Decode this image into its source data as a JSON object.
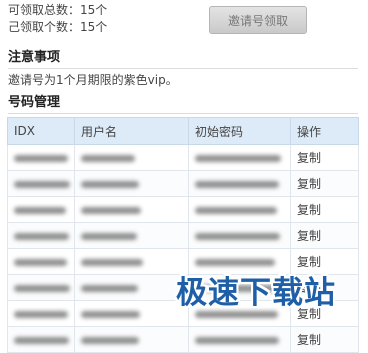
{
  "stats": {
    "total_label": "可领取总数：15个",
    "received_label": "己领取个数：15个"
  },
  "invite_button": "邀请号领取",
  "notice": {
    "title": "注意事项",
    "text": "邀请号为1个月期限的紫色vip。"
  },
  "codes": {
    "title": "号码管理",
    "columns": [
      "IDX",
      "用户名",
      "初始密码",
      "操作"
    ],
    "rows": [
      {
        "action": "复制"
      },
      {
        "action": "复制"
      },
      {
        "action": "复制"
      },
      {
        "action": "复制"
      },
      {
        "action": "复制"
      },
      {
        "action": "复制"
      },
      {
        "action": "复制"
      },
      {
        "action": "复制"
      }
    ]
  },
  "watermark": "极速下载站"
}
